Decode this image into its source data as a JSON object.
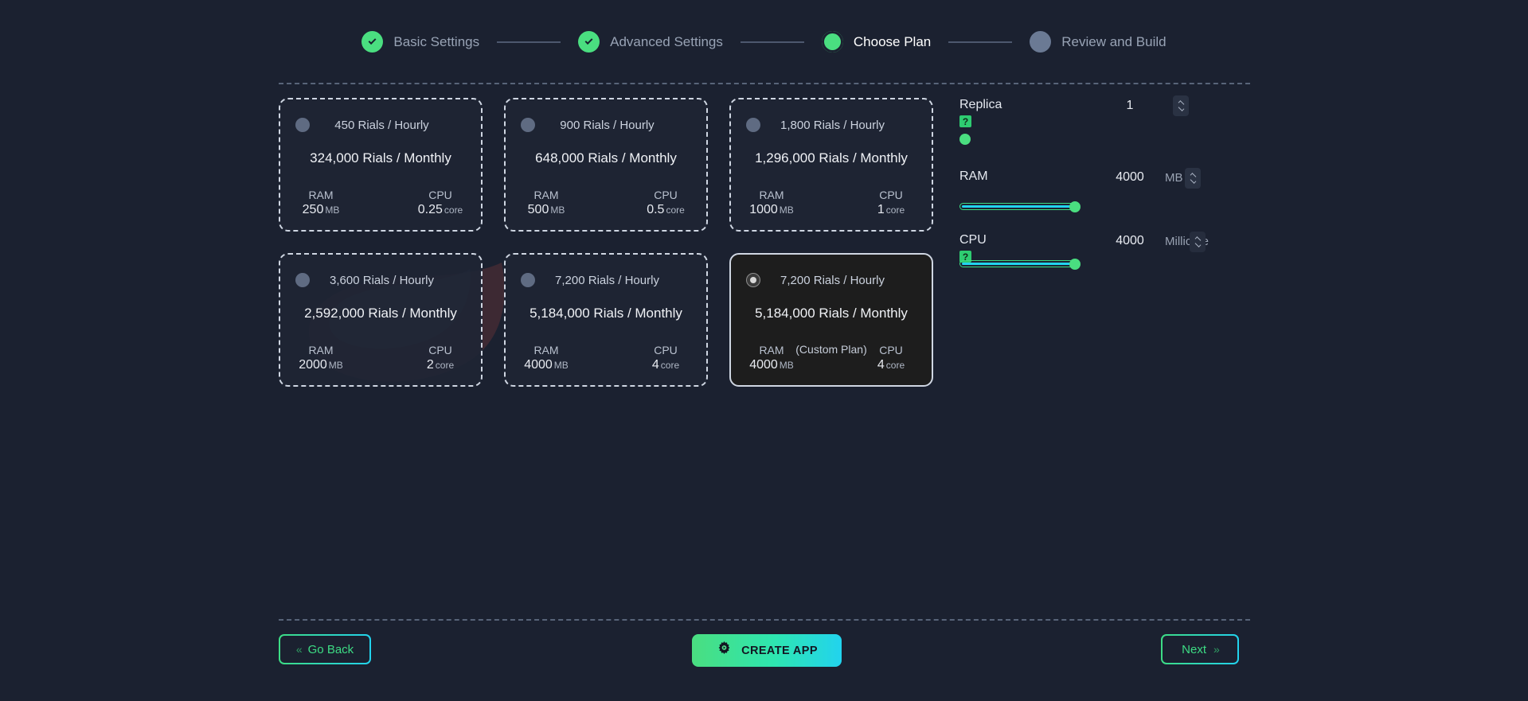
{
  "stepper": {
    "steps": [
      {
        "label": "Basic Settings",
        "state": "done"
      },
      {
        "label": "Advanced Settings",
        "state": "done"
      },
      {
        "label": "Choose Plan",
        "state": "current"
      },
      {
        "label": "Review and Build",
        "state": "pending"
      }
    ]
  },
  "plans": [
    {
      "hourly": "450 Rials / Hourly",
      "monthly": "324,000 Rials / Monthly",
      "ram_label": "RAM",
      "ram_value": "250",
      "ram_unit": "MB",
      "cpu_label": "CPU",
      "cpu_value": "0.25",
      "cpu_unit": "core",
      "selected": false,
      "custom_tag": ""
    },
    {
      "hourly": "900 Rials / Hourly",
      "monthly": "648,000 Rials / Monthly",
      "ram_label": "RAM",
      "ram_value": "500",
      "ram_unit": "MB",
      "cpu_label": "CPU",
      "cpu_value": "0.5",
      "cpu_unit": "core",
      "selected": false,
      "custom_tag": ""
    },
    {
      "hourly": "1,800 Rials / Hourly",
      "monthly": "1,296,000 Rials / Monthly",
      "ram_label": "RAM",
      "ram_value": "1000",
      "ram_unit": "MB",
      "cpu_label": "CPU",
      "cpu_value": "1",
      "cpu_unit": "core",
      "selected": false,
      "custom_tag": ""
    },
    {
      "hourly": "3,600 Rials / Hourly",
      "monthly": "2,592,000 Rials / Monthly",
      "ram_label": "RAM",
      "ram_value": "2000",
      "ram_unit": "MB",
      "cpu_label": "CPU",
      "cpu_value": "2",
      "cpu_unit": "core",
      "selected": false,
      "custom_tag": ""
    },
    {
      "hourly": "7,200 Rials / Hourly",
      "monthly": "5,184,000 Rials / Monthly",
      "ram_label": "RAM",
      "ram_value": "4000",
      "ram_unit": "MB",
      "cpu_label": "CPU",
      "cpu_value": "4",
      "cpu_unit": "core",
      "selected": false,
      "custom_tag": ""
    },
    {
      "hourly": "7,200 Rials / Hourly",
      "monthly": "5,184,000 Rials / Monthly",
      "ram_label": "RAM",
      "ram_value": "4000",
      "ram_unit": "MB",
      "cpu_label": "CPU",
      "cpu_value": "4",
      "cpu_unit": "core",
      "selected": true,
      "custom_tag": "(Custom Plan)"
    }
  ],
  "controls": {
    "replica": {
      "label": "Replica",
      "help": "?",
      "value": "1"
    },
    "ram": {
      "label": "RAM",
      "value": "4000",
      "unit": "MB",
      "slider_percent": 100
    },
    "cpu": {
      "label": "CPU",
      "help": "?",
      "value": "4000",
      "unit": "Millicore",
      "slider_percent": 100
    }
  },
  "footer": {
    "go_back": "Go Back",
    "go_back_arrows": "«",
    "create_app": "CREATE APP",
    "next": "Next",
    "next_arrows": "»"
  },
  "colors": {
    "background": "#1b2130",
    "accent_green": "#4ade80",
    "accent_cyan": "#22d3ee",
    "pending_gray": "#6b7a94",
    "card_bg": "#1e2534",
    "selected_card_bg": "#1d1d1d"
  }
}
